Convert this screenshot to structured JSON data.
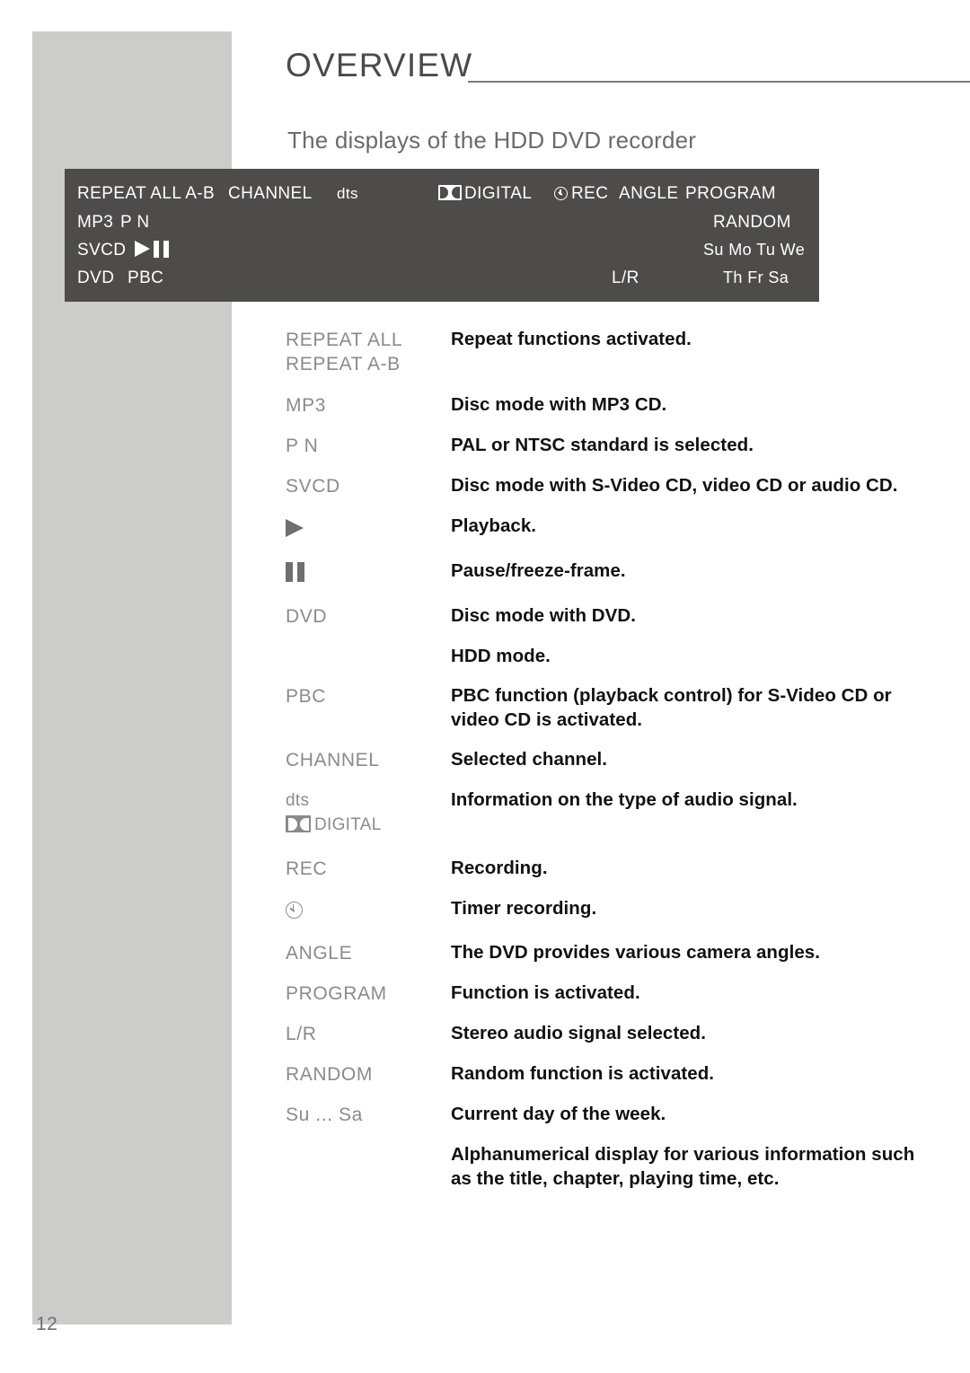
{
  "page": {
    "number": "12",
    "chapter_title": "OVERVIEW",
    "subtitle": "The displays of the HDD DVD recorder"
  },
  "display_panel": {
    "row1": {
      "repeat": "REPEAT ALL A-B",
      "channel": "CHANNEL",
      "dts": "dts",
      "dolby_digital": "DIGITAL",
      "rec": "REC",
      "angle": "ANGLE",
      "program": "PROGRAM"
    },
    "row2": {
      "mp3": "MP3",
      "pal_ntsc": "P  N",
      "random": "RANDOM"
    },
    "row3": {
      "svcd": "SVCD",
      "days_top": "Su Mo Tu We"
    },
    "row4": {
      "dvd": "DVD",
      "pbc": "PBC",
      "lr": "L/R",
      "days_bottom": "Th  Fr  Sa"
    },
    "icons": {
      "play": "play-icon",
      "pause": "pause-icon",
      "timer": "clock-icon",
      "dolby": "dolby-digital-icon"
    }
  },
  "legend": {
    "rows": [
      {
        "symbol": "REPEAT   ALL",
        "symbol2": "REPEAT   A-B",
        "description": "Repeat functions activated.",
        "description2": ""
      },
      {
        "symbol": "MP3",
        "symbol2": "",
        "description": "Disc mode with MP3 CD.",
        "description2": ""
      },
      {
        "symbol": "P  N",
        "symbol2": "",
        "description": "PAL or NTSC standard is selected.",
        "description2": ""
      },
      {
        "symbol": "SVCD",
        "symbol2": "",
        "description": "Disc mode with S-Video CD, video CD or audio CD.",
        "description2": ""
      },
      {
        "symbol": "play-icon",
        "symbol2": "",
        "description": "Playback.",
        "description2": ""
      },
      {
        "symbol": "pause-icon",
        "symbol2": "",
        "description": "Pause/freeze-frame.",
        "description2": ""
      },
      {
        "symbol": "DVD",
        "symbol2": "",
        "description": "Disc mode with DVD.",
        "description2": ""
      },
      {
        "symbol": "",
        "symbol2": "",
        "description": "HDD mode.",
        "description2": ""
      },
      {
        "symbol": "PBC",
        "symbol2": "",
        "description": "PBC function (playback control) for S-Video CD or",
        "description2": "video CD is activated."
      },
      {
        "symbol": "CHANNEL",
        "symbol2": "",
        "description": "Selected channel.",
        "description2": ""
      },
      {
        "symbol": "dts",
        "symbol2": "DIGITAL",
        "description": "Information on the type of audio signal.",
        "description2": ""
      },
      {
        "symbol": "REC",
        "symbol2": "",
        "description": "Recording.",
        "description2": ""
      },
      {
        "symbol": "clock-icon",
        "symbol2": "",
        "description": "Timer recording.",
        "description2": ""
      },
      {
        "symbol": "ANGLE",
        "symbol2": "",
        "description": "The DVD provides various camera angles.",
        "description2": ""
      },
      {
        "symbol": "PROGRAM",
        "symbol2": "",
        "description": "Function is activated.",
        "description2": ""
      },
      {
        "symbol": "L/R",
        "symbol2": "",
        "description": "Stereo audio signal selected.",
        "description2": ""
      },
      {
        "symbol": "RANDOM",
        "symbol2": "",
        "description": "Random function is activated.",
        "description2": ""
      },
      {
        "symbol": "Su ... Sa",
        "symbol2": "",
        "description": "Current day of the week.",
        "description2": ""
      },
      {
        "symbol": "",
        "symbol2": "",
        "description": "Alphanumerical display for various information such",
        "description2": "as the title, chapter, playing time, etc."
      }
    ]
  },
  "colors": {
    "sidebar_gray": "#ccccca",
    "display_dark": "#4e4c4b",
    "symbol_gray": "#8b8b8b",
    "title_gray": "#4a4a4a"
  }
}
